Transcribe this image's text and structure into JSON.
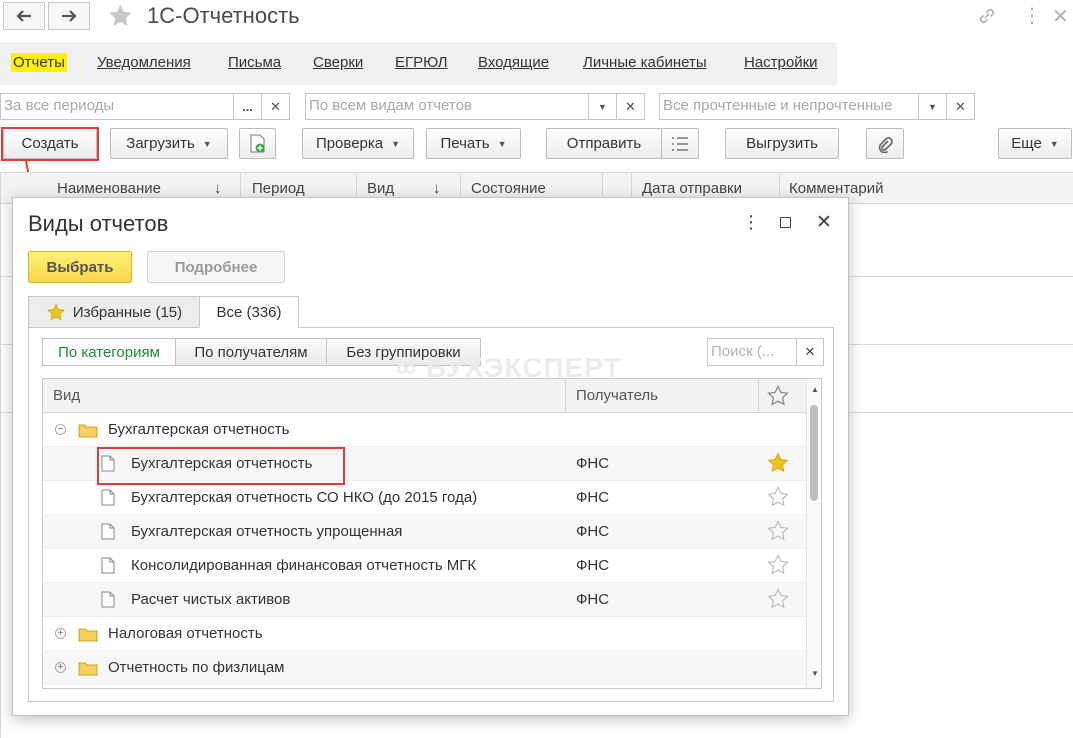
{
  "window": {
    "title": "1С-Отчетность"
  },
  "menu": {
    "items": [
      {
        "label": "Отчеты"
      },
      {
        "label": "Уведомления"
      },
      {
        "label": "Письма"
      },
      {
        "label": "Сверки"
      },
      {
        "label": "ЕГРЮЛ"
      },
      {
        "label": "Входящие"
      },
      {
        "label": "Личные кабинеты"
      },
      {
        "label": "Настройки"
      }
    ],
    "active_index": 0
  },
  "filters": {
    "period_placeholder": "За все периоды",
    "period_select_label": "...",
    "report_type_placeholder": "По всем видам отчетов",
    "read_status_placeholder": "Все прочтенные и непрочтенные"
  },
  "toolbar": {
    "create": "Создать",
    "load": "Загрузить",
    "check": "Проверка",
    "print": "Печать",
    "send": "Отправить",
    "upload": "Выгрузить",
    "more": "Еще"
  },
  "background_table": {
    "columns": [
      "Наименование",
      "Период",
      "Вид",
      "Состояние",
      "Дата отправки",
      "Комментарий"
    ]
  },
  "dialog": {
    "title": "Виды отчетов",
    "select_button": "Выбрать",
    "details_button": "Подробнее",
    "tabs": [
      {
        "label": "Избранные (15)"
      },
      {
        "label": "Все (336)"
      }
    ],
    "active_tab": 1,
    "grouping": [
      {
        "label": "По категориям"
      },
      {
        "label": "По получателям"
      },
      {
        "label": "Без группировки"
      }
    ],
    "active_grouping": 0,
    "search_placeholder": "Поиск (...",
    "watermark": "БУХЭКСПЕРТ",
    "columns": {
      "kind": "Вид",
      "recipient": "Получатель"
    },
    "rows": [
      {
        "type": "group",
        "name": "Бухгалтерская отчетность",
        "expanded": true
      },
      {
        "type": "item",
        "name": "Бухгалтерская отчетность",
        "recipient": "ФНС",
        "favorite": true
      },
      {
        "type": "item",
        "name": "Бухгалтерская отчетность СО НКО (до 2015 года)",
        "recipient": "ФНС",
        "favorite": false
      },
      {
        "type": "item",
        "name": "Бухгалтерская отчетность упрощенная",
        "recipient": "ФНС",
        "favorite": false
      },
      {
        "type": "item",
        "name": "Консолидированная финансовая отчетность МГК",
        "recipient": "ФНС",
        "favorite": false
      },
      {
        "type": "item",
        "name": "Расчет чистых активов",
        "recipient": "ФНС",
        "favorite": false
      },
      {
        "type": "group",
        "name": "Налоговая отчетность",
        "expanded": false
      },
      {
        "type": "group",
        "name": "Отчетность по физлицам",
        "expanded": false
      }
    ]
  },
  "colors": {
    "accent_yellow": "#fff200",
    "highlight_red": "#e03c3c",
    "star_gold": "#f2c21b",
    "active_green": "#1f8a3a"
  }
}
